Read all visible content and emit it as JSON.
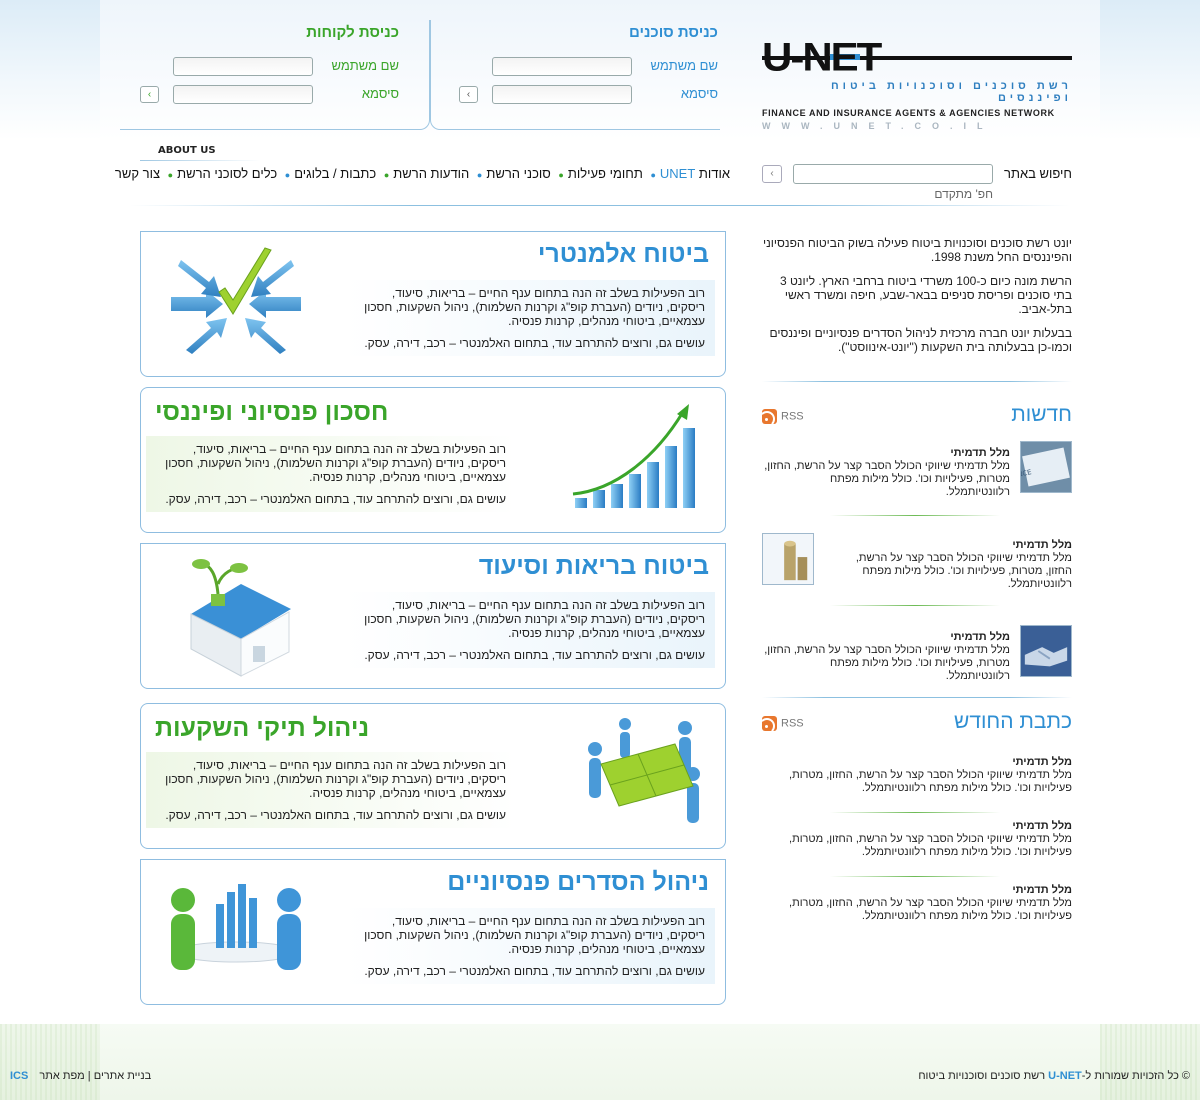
{
  "logo": {
    "main": "U-NET",
    "tagline_he": "רשת סוכנים וסוכנויות ביטוח ופיננסים",
    "tagline_en": "FINANCE AND INSURANCE AGENTS & AGENCIES NETWORK",
    "url": "WWW.UNET.CO.IL"
  },
  "agents_login": {
    "title": "כניסת סוכנים",
    "username_label": "שם משתמש",
    "password_label": "סיסמא",
    "go": "›"
  },
  "clients_login": {
    "title": "כניסת לקוחות",
    "username_label": "שם משתמש",
    "password_label": "סיסמא",
    "go": "›"
  },
  "about_us": "ABOUT US",
  "nav": {
    "items": [
      "אודות",
      "UNET",
      "תחומי פעילות",
      "סוכני הרשת",
      "הודעות הרשת",
      "כתבות / בלוגים",
      "כלים לסוכני הרשת",
      "צור קשר"
    ]
  },
  "search": {
    "label": "חיפוש באתר",
    "advanced": "חפ' מתקדם",
    "go": "›"
  },
  "services": [
    {
      "title": "ביטוח אלמנטרי",
      "p1": "רוב הפעילות בשלב זה הנה בתחום ענף החיים – בריאות, סיעוד, ריסקים, ניודים (העברת קופ\"ג וקרנות השלמות), ניהול השקעות, חסכון עצמאיים, ביטוחי מנהלים, קרנות פנסיה.",
      "p2": "עושים גם, ורוצים להתרחב עוד, בתחום האלמנטרי – רכב, דירה, עסק."
    },
    {
      "title": "חסכון פנסיוני ופיננסי",
      "p1": "רוב הפעילות בשלב זה הנה בתחום ענף החיים – בריאות, סיעוד, ריסקים, ניודים (העברת קופ\"ג וקרנות השלמות), ניהול השקעות, חסכון עצמאיים, ביטוחי מנהלים, קרנות פנסיה.",
      "p2": "עושים גם, ורוצים להתרחב עוד, בתחום האלמנטרי – רכב, דירה, עסק."
    },
    {
      "title": "ביטוח בריאות וסיעוד",
      "p1": "רוב הפעילות בשלב זה הנה בתחום ענף החיים – בריאות, סיעוד, ריסקים, ניודים (העברת קופ\"ג וקרנות השלמות), ניהול השקעות, חסכון עצמאיים, ביטוחי מנהלים, קרנות פנסיה.",
      "p2": "עושים גם, ורוצים להתרחב עוד, בתחום האלמנטרי – רכב, דירה, עסק."
    },
    {
      "title": "ניהול תיקי השקעות",
      "p1": "רוב הפעילות בשלב זה הנה בתחום ענף החיים – בריאות, סיעוד, ריסקים, ניודים (העברת קופ\"ג וקרנות השלמות), ניהול השקעות, חסכון עצמאיים, ביטוחי מנהלים, קרנות פנסיה.",
      "p2": "עושים גם, ורוצים להתרחב עוד, בתחום האלמנטרי – רכב, דירה, עסק."
    },
    {
      "title": "ניהול הסדרים פנסיוניים",
      "p1": "רוב הפעילות בשלב זה הנה בתחום ענף החיים – בריאות, סיעוד, ריסקים, ניודים (העברת קופ\"ג וקרנות השלמות), ניהול השקעות, חסכון עצמאיים, ביטוחי מנהלים, קרנות פנסיה.",
      "p2": "עושים גם, ורוצים להתרחב עוד, בתחום האלמנטרי – רכב, דירה, עסק."
    }
  ],
  "intro": {
    "p1": "יונט רשת סוכנים וסוכנויות ביטוח פעילה בשוק הביטוח הפנסיוני והפיננסים החל משנת 1998.",
    "p2": "הרשת מונה כיום כ-100 משרדי ביטוח ברחבי הארץ. ליונט 3 בתי סוכנים ופריסת סניפים בבאר-שבע, חיפה ומשרד ראשי בתל-אביב.",
    "p3": "בבעלות יונט חברה מרכזית לניהול הסדרים פנסיוניים ופיננסים וכמו-כן בבעלותה בית השקעות (\"יונט-אינווסט\")."
  },
  "news": {
    "title": "חדשות",
    "rss": "RSS",
    "items": [
      {
        "title": "מלל תדמיתי",
        "text": "מלל תדמיתי שיווקי הכולל הסבר קצר על הרשת, החזון, מטרות, פעילויות וכו'. כולל מילות מפתח רלוונטיותמלל."
      },
      {
        "title": "מלל תדמיתי",
        "text": "מלל תדמיתי שיווקי הכולל הסבר קצר על הרשת, החזון, מטרות, פעילויות וכו'. כולל מילות מפתח רלוונטיותמלל."
      },
      {
        "title": "מלל תדמיתי",
        "text": "מלל תדמיתי שיווקי הכולל הסבר קצר על הרשת, החזון, מטרות, פעילויות וכו'. כולל מילות מפתח רלוונטיותמלל."
      }
    ]
  },
  "articles": {
    "title": "כתבת החודש",
    "rss": "RSS",
    "items": [
      {
        "title": "מלל תדמיתי",
        "text": "מלל תדמיתי שיווקי הכולל הסבר קצר על הרשת, החזון, מטרות, פעילויות וכו'. כולל מילות מפתח רלוונטיותמלל."
      },
      {
        "title": "מלל תדמיתי",
        "text": "מלל תדמיתי שיווקי הכולל הסבר קצר על הרשת, החזון, מטרות, פעילויות וכו'. כולל מילות מפתח רלוונטיותמלל."
      },
      {
        "title": "מלל תדמיתי",
        "text": "מלל תדמיתי שיווקי הכולל הסבר קצר על הרשת, החזון, מטרות, פעילויות וכו'. כולל מילות מפתח רלוונטיותמלל."
      }
    ]
  },
  "footer": {
    "copy_prefix": "© כל הזכויות שמורות ל-",
    "brand": "U-NET",
    "copy_suffix": "רשת סוכנים וסוכנויות ביטוח",
    "sitemap": "מפת אתר",
    "sep": "|",
    "credit": "בניית אתרים",
    "ics": "ICS"
  },
  "colors": {
    "blue": "#2f8fd3",
    "green": "#3aa52a"
  }
}
